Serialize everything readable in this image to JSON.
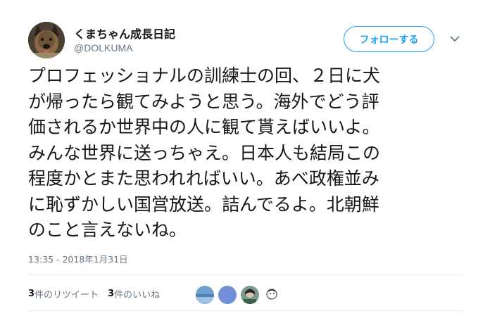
{
  "user": {
    "display_name": "くまちゃん成長日記",
    "handle": "@DOLKUMA"
  },
  "follow_button_label": "フォローする",
  "tweet": {
    "lines": [
      "プロフェッショナルの訓練士の回、２日に犬",
      "が帰ったら観てみようと思う。海外でどう評",
      "価されるか世界中の人に観て貰えばいいよ。",
      "みんな世界に送っちゃえ。日本人も結局この",
      "程度かとまた思われればいい。あべ政権並み",
      "に恥ずかしい国営放送。詰んでるよ。北朝鮮",
      "のこと言えないね。"
    ],
    "timestamp": "13:35 - 2018年1月31日"
  },
  "stats": {
    "retweets_count": "3",
    "retweets_label": "件のリツイート",
    "likes_count": "3",
    "likes_label": "件のいいね"
  },
  "colors": {
    "accent": "#1da1f2",
    "secondary_text": "#657786",
    "divider": "#e6ecf0"
  },
  "icons": {
    "more": "chevron-down-icon"
  }
}
